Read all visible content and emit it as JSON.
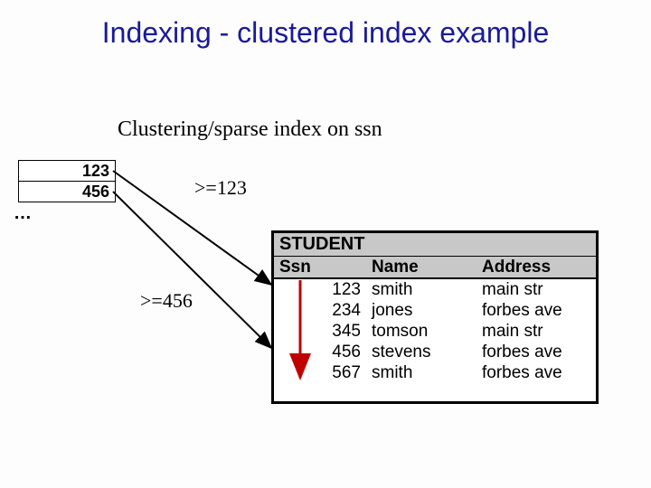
{
  "title": "Indexing - clustered index example",
  "subtitle": "Clustering/sparse index on ssn",
  "index": {
    "rows": [
      "123",
      "456"
    ],
    "ellipsis": "…"
  },
  "labels": {
    "ge123": ">=123",
    "ge456": ">=456"
  },
  "student": {
    "caption": "STUDENT",
    "headers": {
      "ssn": "Ssn",
      "name": "Name",
      "address": "Address"
    },
    "rows": [
      {
        "ssn": "123",
        "name": "smith",
        "address": "main str"
      },
      {
        "ssn": "234",
        "name": "jones",
        "address": "forbes ave"
      },
      {
        "ssn": "345",
        "name": "tomson",
        "address": "main str"
      },
      {
        "ssn": "456",
        "name": "stevens",
        "address": "forbes ave"
      },
      {
        "ssn": "567",
        "name": "smith",
        "address": "forbes ave"
      }
    ]
  }
}
